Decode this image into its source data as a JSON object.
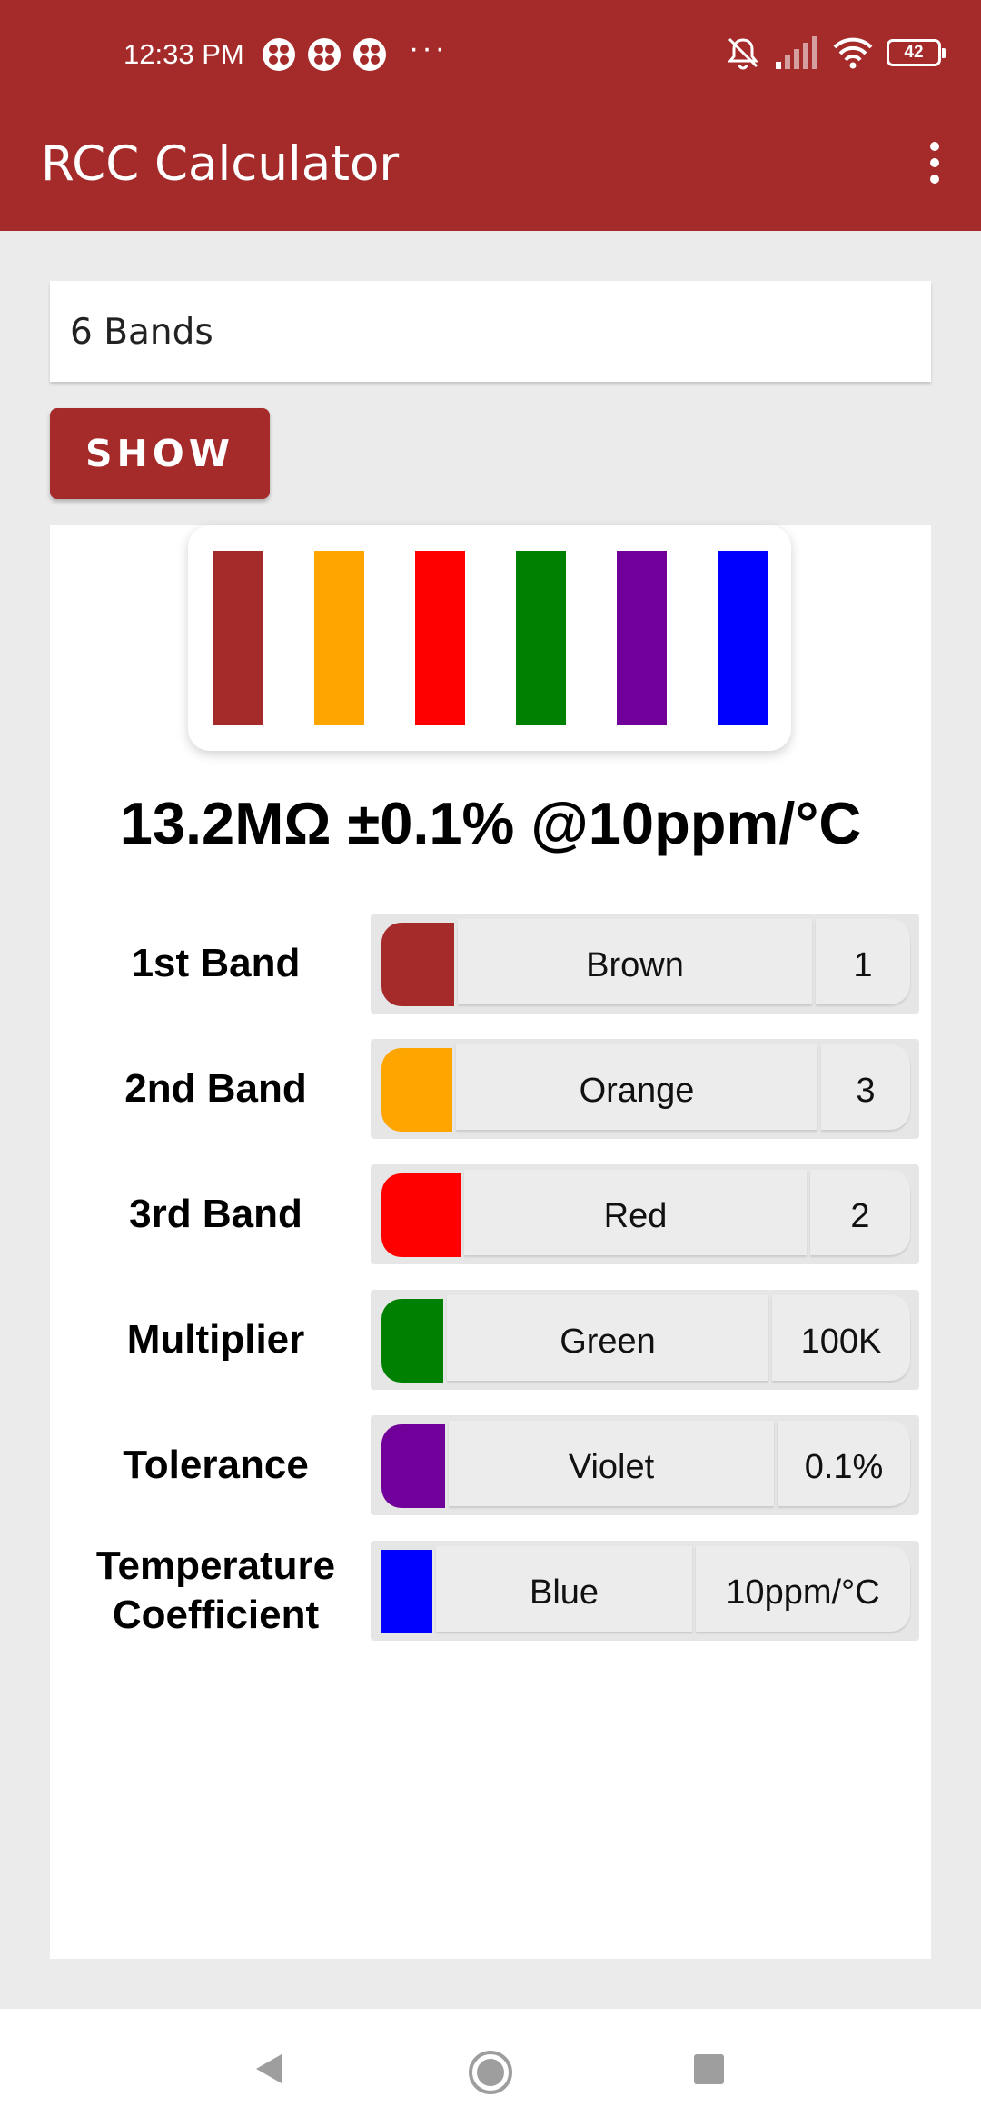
{
  "status_bar": {
    "time": "12:33 PM",
    "more": "···",
    "battery": "42"
  },
  "app_bar": {
    "title": "RCC Calculator",
    "color": "#a52a2a"
  },
  "band_count_spinner": {
    "value": "6 Bands"
  },
  "show_button": {
    "label": "SHOW"
  },
  "resistor": {
    "bands": [
      "#a52a2a",
      "#ffa500",
      "#ff0000",
      "#008000",
      "#700099",
      "#0000ff"
    ]
  },
  "result": {
    "text": "13.2MΩ ±0.1% @10ppm/°C"
  },
  "rows": [
    {
      "label": "1st Band",
      "color_name": "Brown",
      "value": "1",
      "color": "#a52a2a"
    },
    {
      "label": "2nd Band",
      "color_name": "Orange",
      "value": "3",
      "color": "#ffa500"
    },
    {
      "label": "3rd Band",
      "color_name": "Red",
      "value": "2",
      "color": "#ff0000"
    },
    {
      "label": "Multiplier",
      "color_name": "Green",
      "value": "100K",
      "color": "#008000"
    },
    {
      "label": "Tolerance",
      "color_name": "Violet",
      "value": "0.1%",
      "color": "#700099"
    },
    {
      "label_line1": "Temperature",
      "label_line2": "Coefficient",
      "color_name": "Blue",
      "value": "10ppm/°C",
      "color": "#0000ff"
    }
  ]
}
